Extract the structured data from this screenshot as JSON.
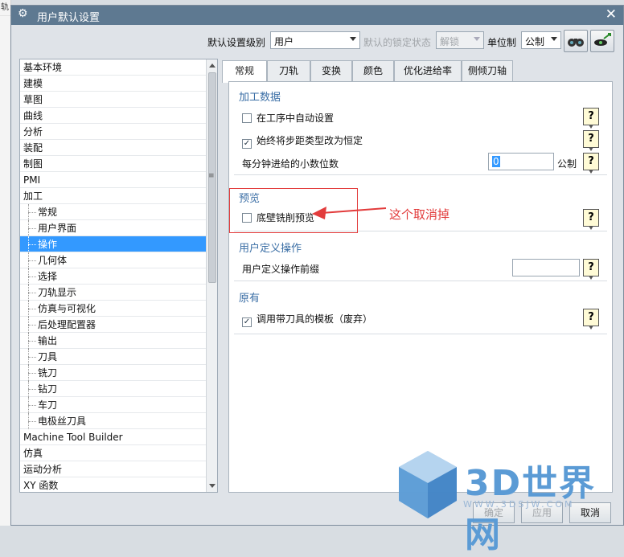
{
  "left_strip": [
    "轨"
  ],
  "window": {
    "title": "用户默认设置"
  },
  "toolbar": {
    "level_label": "默认设置级别",
    "level_value": "用户",
    "lock_label": "默认的锁定状态",
    "lock_value": "解锁",
    "unit_label": "单位制",
    "unit_value": "公制"
  },
  "tree": {
    "items": [
      {
        "label": "基本环境",
        "child": false
      },
      {
        "label": "建模",
        "child": false
      },
      {
        "label": "草图",
        "child": false
      },
      {
        "label": "曲线",
        "child": false
      },
      {
        "label": "分析",
        "child": false
      },
      {
        "label": "装配",
        "child": false
      },
      {
        "label": "制图",
        "child": false
      },
      {
        "label": "PMI",
        "child": false
      },
      {
        "label": "加工",
        "child": false
      },
      {
        "label": "常规",
        "child": true
      },
      {
        "label": "用户界面",
        "child": true
      },
      {
        "label": "操作",
        "child": true,
        "selected": true
      },
      {
        "label": "几何体",
        "child": true
      },
      {
        "label": "选择",
        "child": true
      },
      {
        "label": "刀轨显示",
        "child": true
      },
      {
        "label": "仿真与可视化",
        "child": true
      },
      {
        "label": "后处理配置器",
        "child": true
      },
      {
        "label": "输出",
        "child": true
      },
      {
        "label": "刀具",
        "child": true
      },
      {
        "label": "铣刀",
        "child": true
      },
      {
        "label": "钻刀",
        "child": true
      },
      {
        "label": "车刀",
        "child": true
      },
      {
        "label": "电极丝刀具",
        "child": true
      },
      {
        "label": "Machine Tool Builder",
        "child": false
      },
      {
        "label": "仿真",
        "child": false
      },
      {
        "label": "运动分析",
        "child": false
      },
      {
        "label": "XY 函数",
        "child": false
      }
    ]
  },
  "tabs": [
    "常规",
    "刀轨",
    "变换",
    "颜色",
    "优化进给率",
    "侧倾刀轴"
  ],
  "active_tab": 0,
  "groups": {
    "machining": {
      "title": "加工数据",
      "auto_set": {
        "label": "在工序中自动设置",
        "checked": false
      },
      "const_step": {
        "label": "始终将步距类型改为恒定",
        "checked": true
      },
      "decimals": {
        "label": "每分钟进给的小数位数",
        "value": "0",
        "unit": "公制"
      }
    },
    "preview": {
      "title": "预览",
      "floor_wall": {
        "label": "底壁铣削预览",
        "checked": false
      }
    },
    "user_op": {
      "title": "用户定义操作",
      "prefix_label": "用户定义操作前缀",
      "prefix_value": ""
    },
    "legacy": {
      "title": "原有",
      "template": {
        "label": "调用带刀具的模板（废弃）",
        "checked": true
      }
    }
  },
  "annotation": "这个取消掉",
  "buttons": {
    "ok": "确定",
    "apply": "应用",
    "cancel": "取消"
  },
  "watermark": {
    "title": "3D世界网",
    "url": "WWW.3DSJW.COM"
  },
  "colors": {
    "titlebar": "#5e7991",
    "selection": "#3399ff",
    "group_title": "#3a6ea5",
    "annotation": "#e23b3b",
    "watermark": "#5b9bd5"
  }
}
